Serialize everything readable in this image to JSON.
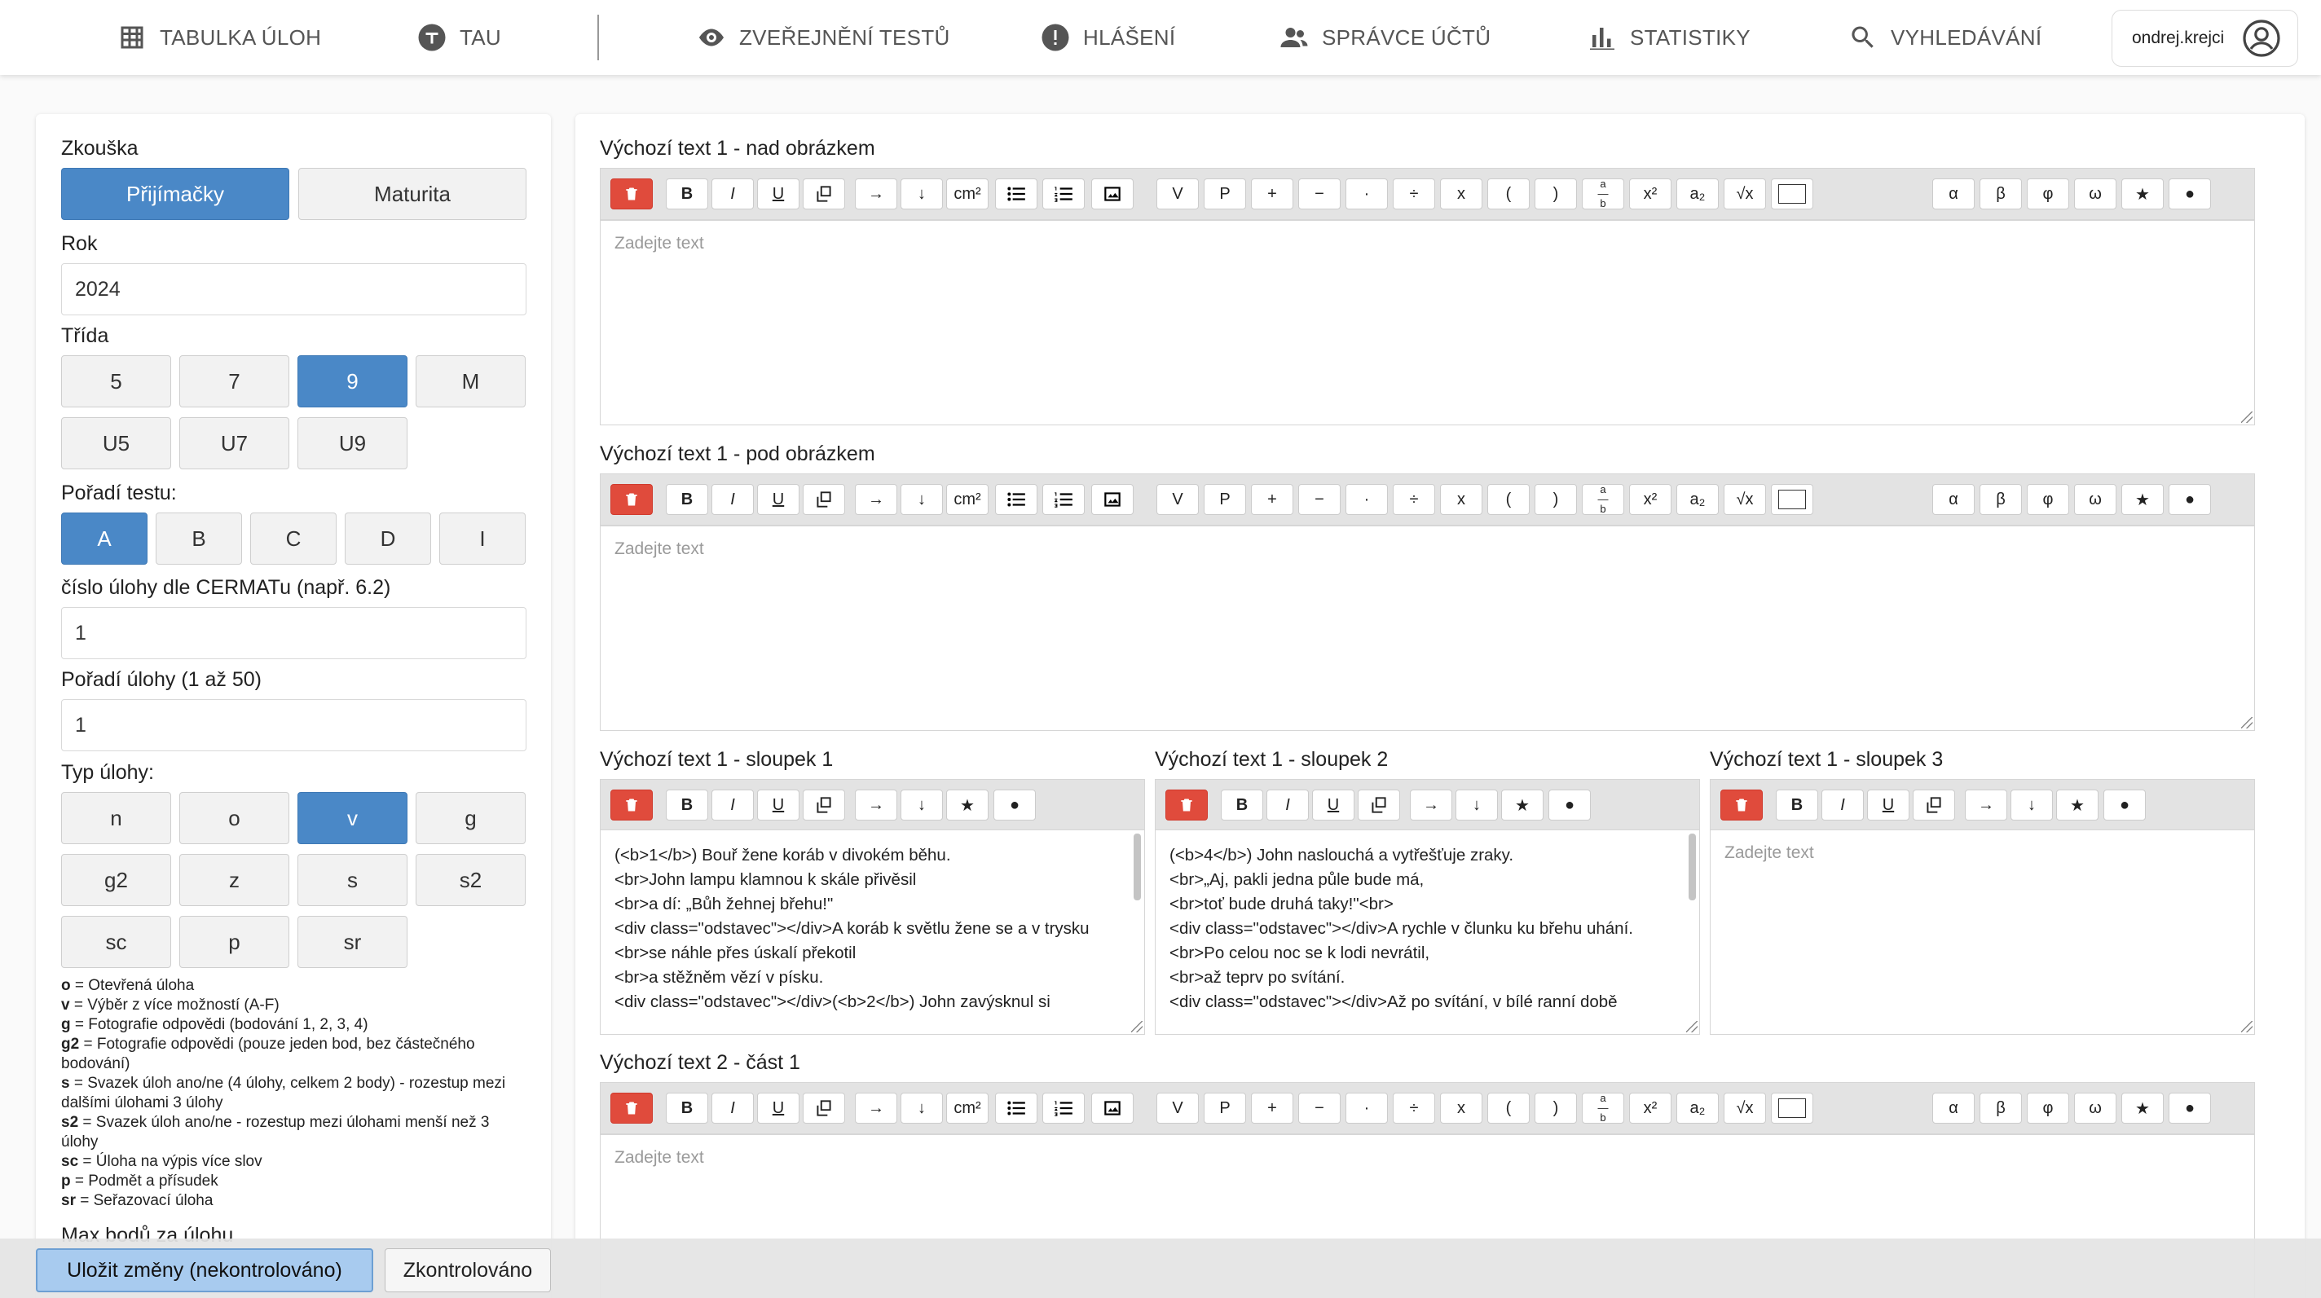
{
  "nav": {
    "items": [
      {
        "name": "nav-item-tabulka-uloh",
        "icon": "table-icon",
        "label": "TABULKA ÚLOH"
      },
      {
        "name": "nav-item-tau",
        "icon": "tau-icon",
        "label": "TAU"
      },
      {
        "name": "nav-item-zverejneni-testu",
        "icon": "eye-icon",
        "label": "ZVEŘEJNĚNÍ TESTŮ"
      },
      {
        "name": "nav-item-hlaseni",
        "icon": "alert-icon",
        "label": "HLÁŠENÍ"
      },
      {
        "name": "nav-item-spravce-uctu",
        "icon": "people-icon",
        "label": "SPRÁVCE ÚČTŮ"
      },
      {
        "name": "nav-item-statistiky",
        "icon": "bar-chart-icon",
        "label": "STATISTIKY"
      },
      {
        "name": "nav-item-vyhledavani",
        "icon": "search-icon",
        "label": "VYHLEDÁVÁNÍ"
      }
    ],
    "user": "ondrej.krejci"
  },
  "form": {
    "zkouska": {
      "label": "Zkouška",
      "options": [
        "Přijímačky",
        "Maturita"
      ],
      "selected": "Přijímačky"
    },
    "rok": {
      "label": "Rok",
      "value": "2024"
    },
    "trida": {
      "label": "Třída",
      "options": [
        "5",
        "7",
        "9",
        "M",
        "U5",
        "U7",
        "U9"
      ],
      "selected": "9"
    },
    "poradi_testu": {
      "label": "Pořadí testu:",
      "options": [
        "A",
        "B",
        "C",
        "D",
        "I"
      ],
      "selected": "A"
    },
    "cislo_ulohy": {
      "label": "číslo úlohy dle CERMATu (např. 6.2)",
      "value": "1"
    },
    "poradi_ulohy": {
      "label": "Pořadí úlohy (1 až 50)",
      "value": "1"
    },
    "typ_ulohy": {
      "label": "Typ úlohy:",
      "options": [
        "n",
        "o",
        "v",
        "g",
        "g2",
        "z",
        "s",
        "s2",
        "sc",
        "p",
        "sr"
      ],
      "selected": "v"
    },
    "legend": [
      {
        "key": "o",
        "text": " = Otevřená úloha"
      },
      {
        "key": "v",
        "text": " = Výběr z více možností (A-F)"
      },
      {
        "key": "g",
        "text": " = Fotografie odpovědi (bodování 1, 2, 3, 4)"
      },
      {
        "key": "g2",
        "text": " = Fotografie odpovědi (pouze jeden bod, bez částečného bodování)"
      },
      {
        "key": "s",
        "text": " = Svazek úloh ano/ne (4 úlohy, celkem 2 body) - rozestup mezi dalšími úlohami 3 úlohy"
      },
      {
        "key": "s2",
        "text": " = Svazek úloh ano/ne - rozestup mezi úlohami menší než 3 úlohy"
      },
      {
        "key": "sc",
        "text": " = Úloha na výpis více slov"
      },
      {
        "key": "p",
        "text": " = Podmět a přísudek"
      },
      {
        "key": "sr",
        "text": " = Seřazovací úloha"
      }
    ],
    "max_body_label": "Max bodů za úlohu"
  },
  "editors": {
    "placeholder": "Zadejte text",
    "full_toolbar": {
      "group1": [
        "delete-icon",
        "B",
        "I",
        "U",
        "copy-icon",
        "→",
        "↓",
        "cm²",
        "bullet-list-icon",
        "numbered-list-icon",
        "image-icon"
      ],
      "group2": [
        "V",
        "P",
        "+",
        "−",
        "·",
        "÷",
        "x",
        "(",
        ")",
        "a/b",
        "x²",
        "a₂",
        "√x",
        "box"
      ],
      "group3": [
        "α",
        "β",
        "φ",
        "ω",
        "★",
        "●"
      ]
    },
    "small_toolbar": [
      "delete-icon",
      "B",
      "I",
      "U",
      "copy-icon",
      "→",
      "↓",
      "★",
      "●"
    ],
    "nad": {
      "title": "Výchozí text 1 - nad obrázkem"
    },
    "pod": {
      "title": "Výchozí text 1 - pod obrázkem"
    },
    "sloupek1": {
      "title": "Výchozí text 1 - sloupek 1",
      "content": "(<b>1</b>) Bouř žene koráb v divokém běhu.\n<br>John lampu klamnou k skále přivěsil\n<br>a dí: „Bůh žehnej břehu!\"\n<div class=\"odstavec\"></div>A koráb k světlu žene se a v trysku\n<br>se náhle přes úskalí překotil\n<br>a stěžněm vězí v písku.\n<div class=\"odstavec\"></div>(<b>2</b>) John zavýsknul si"
    },
    "sloupek2": {
      "title": "Výchozí text 1 - sloupek 2",
      "content": "(<b>4</b>) John naslouchá a vytřešťuje zraky.\n<br>„Aj, pakli jedna půle bude má,\n<br>toť bude druhá taky!\"<br>\n<div class=\"odstavec\"></div>A rychle v člunku ku břehu uhání.\n<br>Po celou noc se k lodi nevrátil,\n<br>až teprv po svítání.\n<div class=\"odstavec\"></div>Až po svítání, v bílé ranní době"
    },
    "sloupek3": {
      "title": "Výchozí text 1 - sloupek 3"
    },
    "cast1": {
      "title": "Výchozí text 2 - část 1"
    }
  },
  "footer": {
    "save_label": "Uložit změny (nekontrolováno)",
    "checked_label": "Zkontrolováno"
  }
}
